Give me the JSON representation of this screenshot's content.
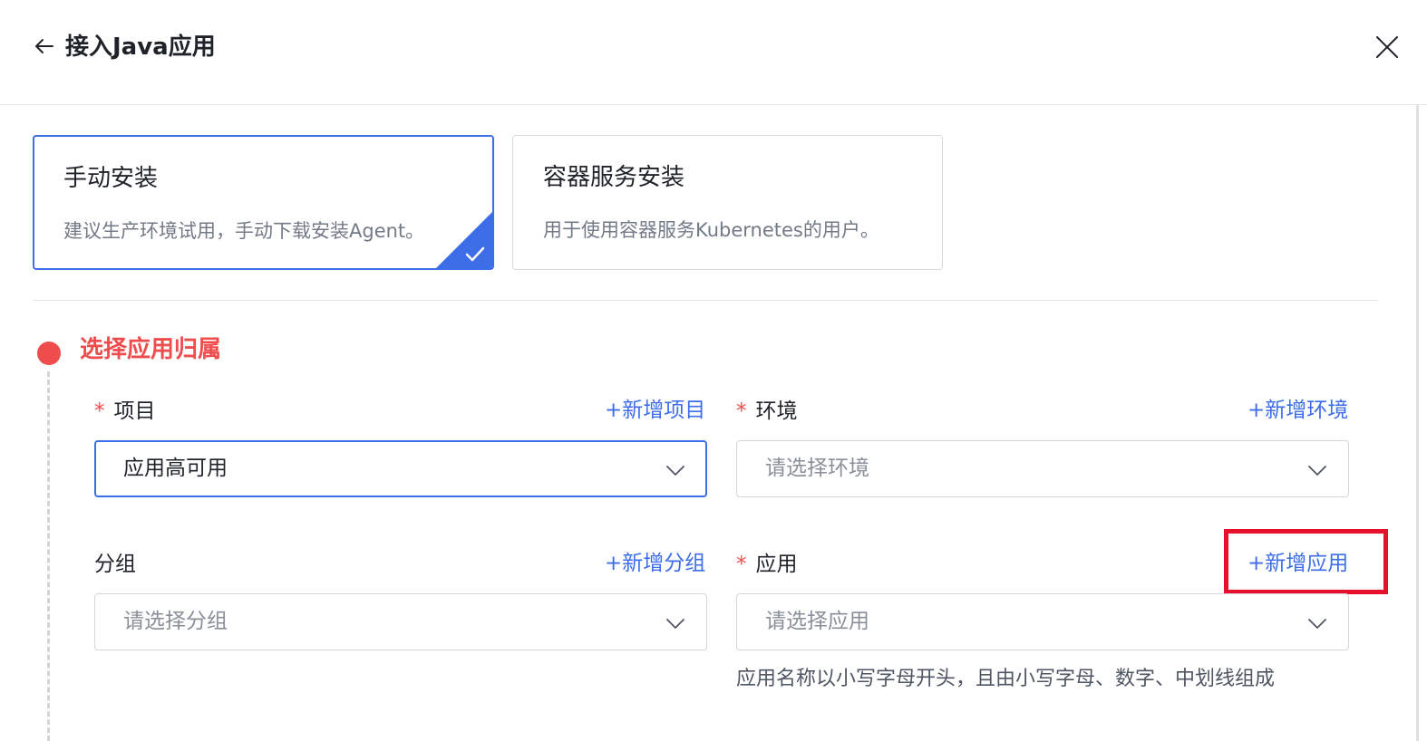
{
  "header": {
    "title": "接入Java应用",
    "back_icon": "arrow-left-icon",
    "close_icon": "close-icon"
  },
  "install_options": [
    {
      "title": "手动安装",
      "description": "建议生产环境试用，手动下载安装Agent。",
      "selected": true
    },
    {
      "title": "容器服务安装",
      "description": "用于使用容器服务Kubernetes的用户。",
      "selected": false
    }
  ],
  "step": {
    "title": "选择应用归属"
  },
  "form": {
    "required_mark": "*",
    "project": {
      "label": "项目",
      "add_link": "+新增项目",
      "value": "应用高可用"
    },
    "environment": {
      "label": "环境",
      "add_link": "+新增环境",
      "placeholder": "请选择环境"
    },
    "group": {
      "label": "分组",
      "add_link": "+新增分组",
      "placeholder": "请选择分组"
    },
    "application": {
      "label": "应用",
      "add_link": "+新增应用",
      "placeholder": "请选择应用",
      "hint": "应用名称以小写字母开头，且由小写字母、数字、中划线组成"
    }
  },
  "colors": {
    "primary": "#3d6ee8",
    "required": "#ef4d4d",
    "highlight": "#e8112d"
  }
}
